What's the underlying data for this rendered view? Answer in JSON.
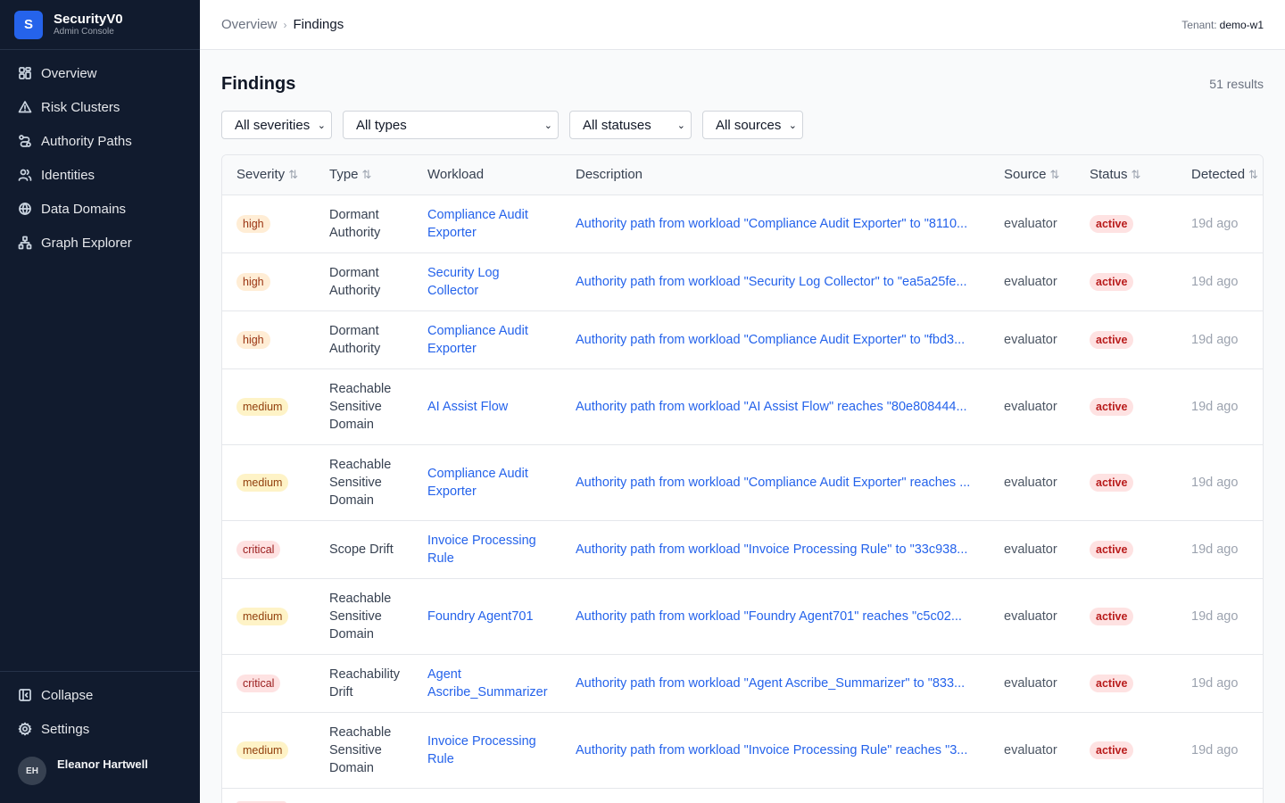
{
  "app": {
    "name": "SecurityV0",
    "subtitle": "Admin Console",
    "logo_letter": "S"
  },
  "sidebar": {
    "items": [
      {
        "label": "Overview",
        "icon": "grid-icon"
      },
      {
        "label": "Risk Clusters",
        "icon": "warning-triangle-icon"
      },
      {
        "label": "Authority Paths",
        "icon": "route-icon"
      },
      {
        "label": "Identities",
        "icon": "users-icon"
      },
      {
        "label": "Data Domains",
        "icon": "globe-icon"
      },
      {
        "label": "Graph Explorer",
        "icon": "graph-icon"
      }
    ],
    "collapse_label": "Collapse",
    "settings_label": "Settings",
    "user": {
      "initials": "EH",
      "name": "Eleanor Hartwell"
    }
  },
  "header": {
    "breadcrumb": [
      "Overview",
      "Findings"
    ],
    "tenant_label": "Tenant:",
    "tenant_value": "demo-w1"
  },
  "main": {
    "title": "Findings",
    "result_count": "51 results",
    "filters": [
      {
        "value": "All severities"
      },
      {
        "value": "All types"
      },
      {
        "value": "All statuses"
      },
      {
        "value": "All sources"
      }
    ],
    "columns": [
      "Severity",
      "Type",
      "Workload",
      "Description",
      "Source",
      "Status",
      "Detected"
    ],
    "rows": [
      {
        "severity": "high",
        "type": "Dormant Authority",
        "workload": "Compliance Audit Exporter",
        "description": "Authority path from workload \"Compliance Audit Exporter\" to \"8110...",
        "source": "evaluator",
        "status": "active",
        "detected": "19d ago"
      },
      {
        "severity": "high",
        "type": "Dormant Authority",
        "workload": "Security Log Collector",
        "description": "Authority path from workload \"Security Log Collector\" to \"ea5a25fe...",
        "source": "evaluator",
        "status": "active",
        "detected": "19d ago"
      },
      {
        "severity": "high",
        "type": "Dormant Authority",
        "workload": "Compliance Audit Exporter",
        "description": "Authority path from workload \"Compliance Audit Exporter\" to \"fbd3...",
        "source": "evaluator",
        "status": "active",
        "detected": "19d ago"
      },
      {
        "severity": "medium",
        "type": "Reachable Sensitive Domain",
        "workload": "AI Assist Flow",
        "description": "Authority path from workload \"AI Assist Flow\" reaches \"80e808444...",
        "source": "evaluator",
        "status": "active",
        "detected": "19d ago"
      },
      {
        "severity": "medium",
        "type": "Reachable Sensitive Domain",
        "workload": "Compliance Audit Exporter",
        "description": "Authority path from workload \"Compliance Audit Exporter\" reaches ...",
        "source": "evaluator",
        "status": "active",
        "detected": "19d ago"
      },
      {
        "severity": "critical",
        "type": "Scope Drift",
        "workload": "Invoice Processing Rule",
        "description": "Authority path from workload \"Invoice Processing Rule\" to \"33c938...",
        "source": "evaluator",
        "status": "active",
        "detected": "19d ago"
      },
      {
        "severity": "medium",
        "type": "Reachable Sensitive Domain",
        "workload": "Foundry Agent701",
        "description": "Authority path from workload \"Foundry Agent701\" reaches \"c5c02...",
        "source": "evaluator",
        "status": "active",
        "detected": "19d ago"
      },
      {
        "severity": "critical",
        "type": "Reachability Drift",
        "workload": "Agent Ascribe_Summarizer",
        "description": "Authority path from workload \"Agent Ascribe_Summarizer\" to \"833...",
        "source": "evaluator",
        "status": "active",
        "detected": "19d ago"
      },
      {
        "severity": "medium",
        "type": "Reachable Sensitive Domain",
        "workload": "Invoice Processing Rule",
        "description": "Authority path from workload \"Invoice Processing Rule\" reaches \"3...",
        "source": "evaluator",
        "status": "active",
        "detected": "19d ago"
      }
    ]
  }
}
